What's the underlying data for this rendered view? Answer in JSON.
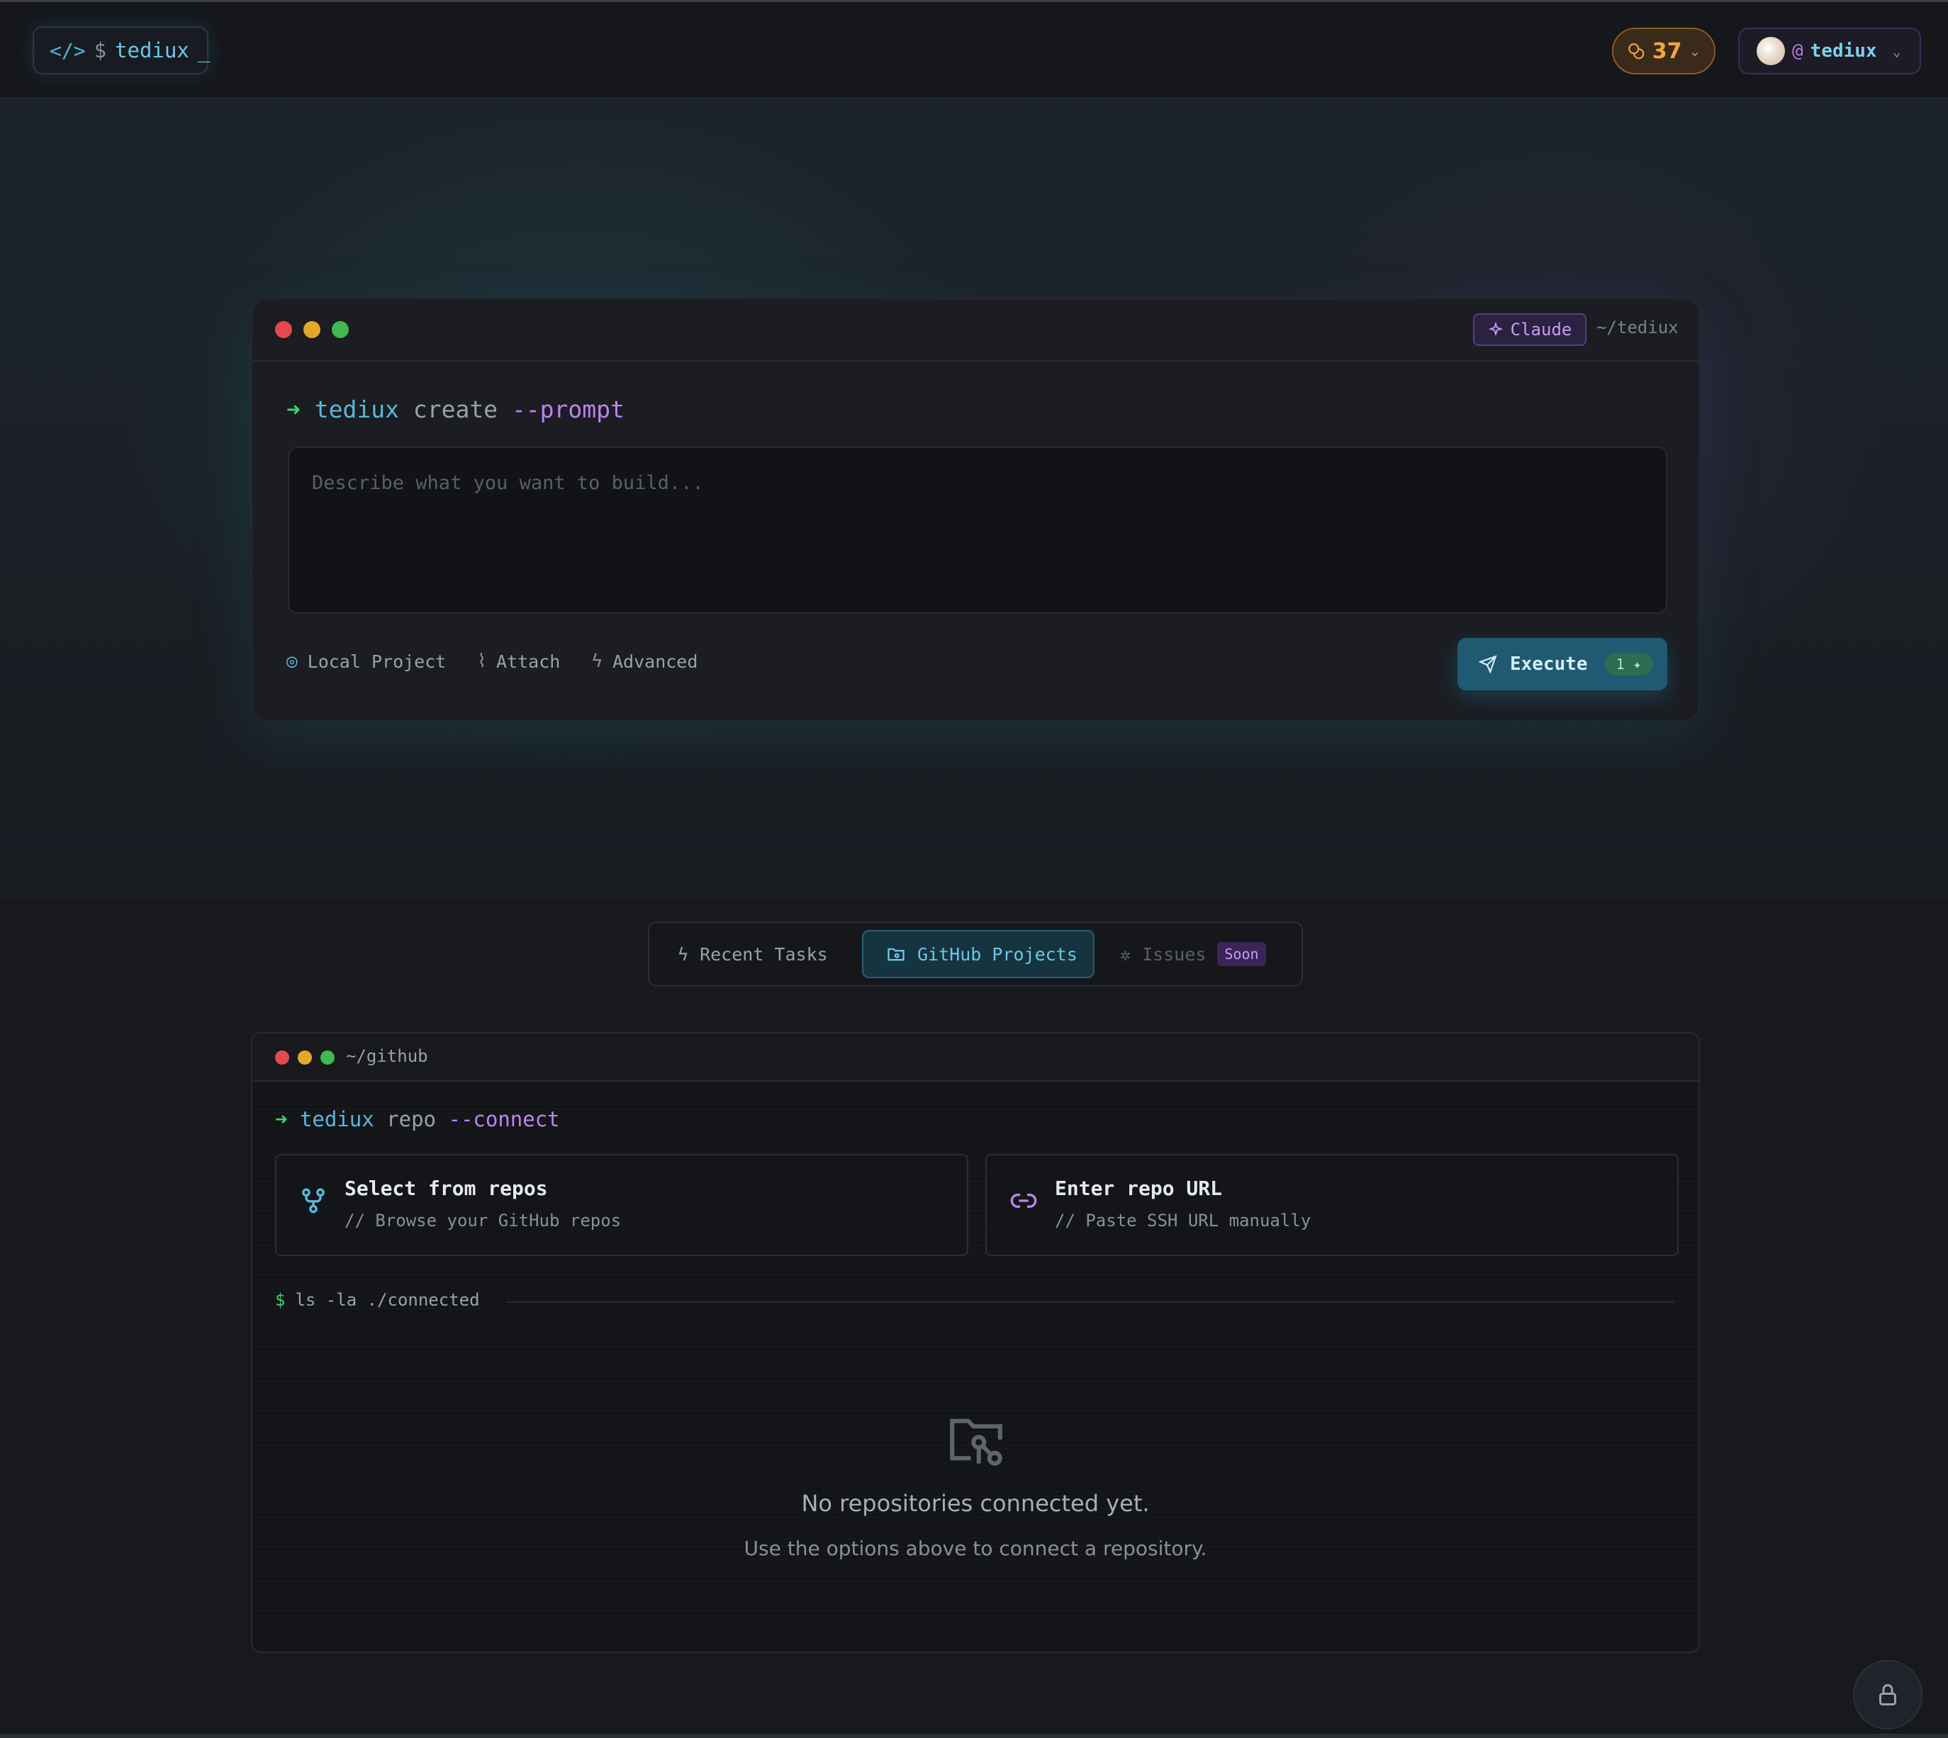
{
  "header": {
    "logo_icon": "code-icon",
    "logo_prompt": "$",
    "logo_name": "tediux",
    "logo_cursor": "_",
    "credits": "37",
    "user_at": "@",
    "user_name": "tediux"
  },
  "prompt_card": {
    "model": "Claude",
    "path": "~/tediux",
    "cmd_arrow": "➜",
    "cmd_bin": "tediux",
    "cmd_sub": "create",
    "cmd_flag": "--prompt",
    "placeholder": "Describe what you want to build...",
    "options": [
      "Local Project",
      "Attach",
      "Advanced"
    ],
    "execute_label": "Execute",
    "execute_badge": "1 ✦"
  },
  "tabs": {
    "recent": "Recent Tasks",
    "github": "GitHub Projects",
    "issues": "Issues",
    "issues_badge": "Soon"
  },
  "github_panel": {
    "path": "~/github",
    "cmd_arrow": "➜",
    "cmd_bin": "tediux",
    "cmd_sub": "repo",
    "cmd_flag": "--connect",
    "select_title": "Select from repos",
    "select_sub": "// Browse your GitHub repos",
    "url_title": "Enter repo URL",
    "url_sub": "// Paste SSH URL manually",
    "ls_prompt": "$",
    "ls_cmd": "ls -la ./connected",
    "empty_title": "No repositories connected yet.",
    "empty_sub": "Use the options above to connect a repository."
  },
  "colors": {
    "accent_cyan": "#5bb8d8",
    "accent_purple": "#c083f0",
    "accent_green": "#3fd36f",
    "credits_orange": "#f2a541"
  }
}
